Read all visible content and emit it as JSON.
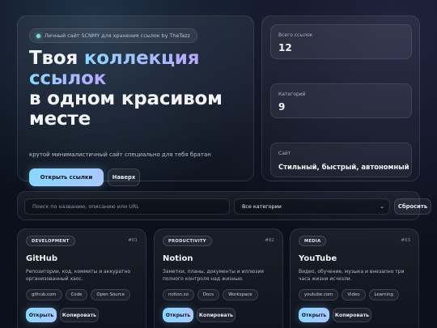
{
  "hero": {
    "pill_text": "Личный сайт SCNMY для хранения ссылок by TheTazz",
    "title_line1": "Твоя",
    "title_highlight1": "коллекция",
    "title_highlight2": "ссылок",
    "title_line3": "в одном красивом",
    "title_line4": "месте",
    "subtitle": "крутой минималистичный сайт специально для тебя братан",
    "open_links_label": "Открыть ссылки",
    "back_label": "Наверх"
  },
  "stats": [
    {
      "label": "Всего ссылок",
      "value": "12"
    },
    {
      "label": "Категорий",
      "value": "9"
    },
    {
      "label": "Сайт",
      "value": "Стильный, быстрый, автономный"
    }
  ],
  "search": {
    "placeholder": "Поиск по названию, описанию или URL",
    "category_selected": "Все категории",
    "reset_label": "Сбросить"
  },
  "cards": [
    {
      "tag": "DEVELOPMENT",
      "number": "#01",
      "title": "GitHub",
      "desc": "Репозитории, код, коммиты и аккуратно организованный хаос.",
      "chips": [
        "github.com",
        "Code",
        "Open Source"
      ],
      "open_label": "Открыть",
      "copy_label": "Копировать"
    },
    {
      "tag": "PRODUCTIVITY",
      "number": "#02",
      "title": "Notion",
      "desc": "Заметки, планы, документы и иллюзия полного контроля над жизнью.",
      "chips": [
        "notion.so",
        "Docs",
        "Workspace"
      ],
      "open_label": "Открыть",
      "copy_label": "Копировать"
    },
    {
      "tag": "MEDIA",
      "number": "#03",
      "title": "YouTube",
      "desc": "Видео, обучение, музыка и внезапно три часа жизни исчезли.",
      "chips": [
        "youtube.com",
        "Video",
        "Learning"
      ],
      "open_label": "Открыть",
      "copy_label": "Копировать"
    }
  ]
}
